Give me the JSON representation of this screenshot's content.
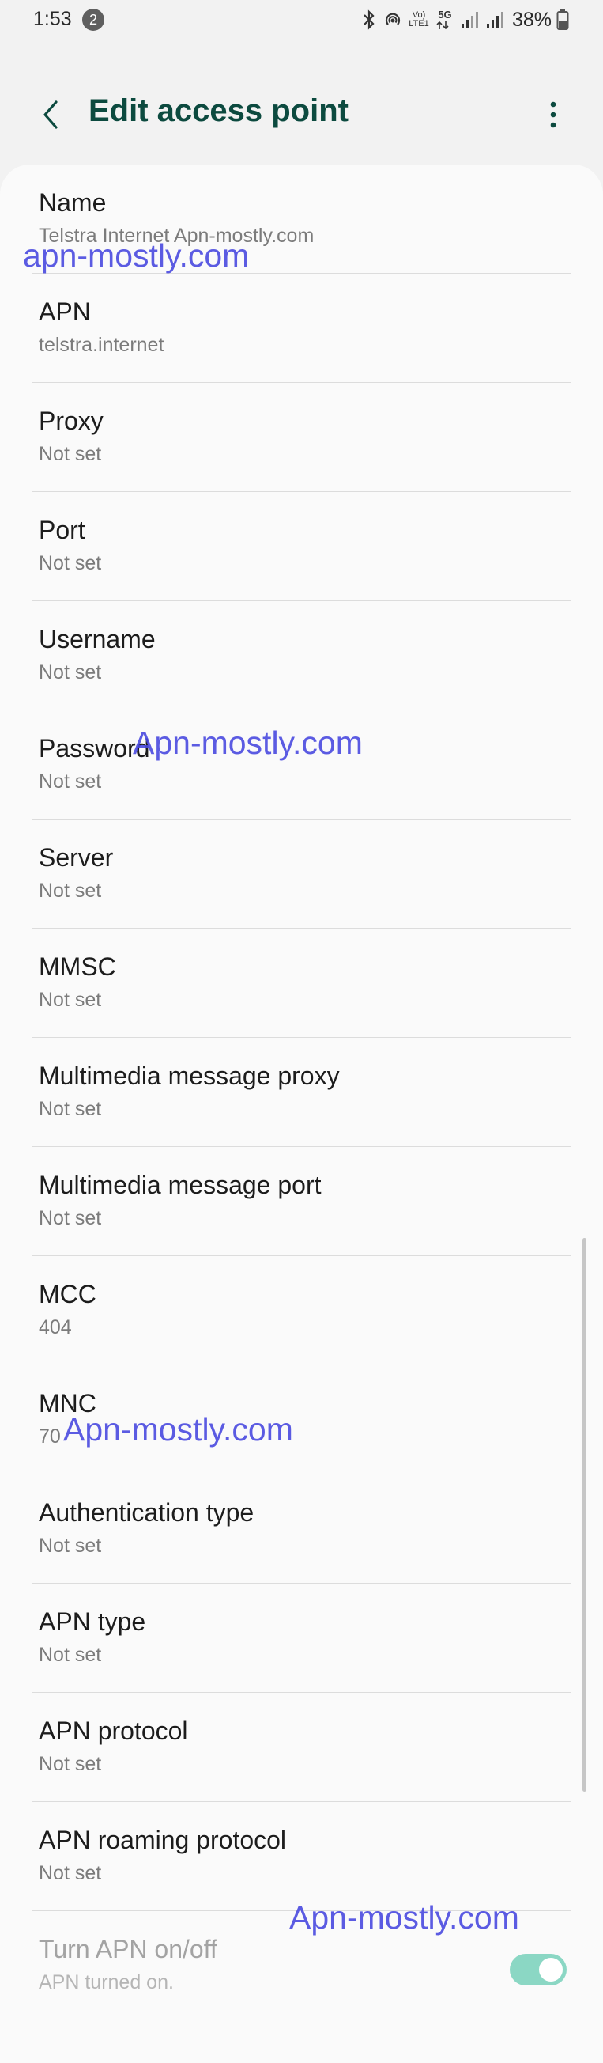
{
  "status_bar": {
    "time": "1:53",
    "notification_count": "2",
    "volte_label": "Vo)\nLTE1",
    "network_label": "5G",
    "battery_percent": "38%"
  },
  "header": {
    "title": "Edit access point"
  },
  "fields": [
    {
      "title": "Name",
      "value": "Telstra Internet Apn-mostly.com"
    },
    {
      "title": "APN",
      "value": "telstra.internet"
    },
    {
      "title": "Proxy",
      "value": "Not set"
    },
    {
      "title": "Port",
      "value": "Not set"
    },
    {
      "title": "Username",
      "value": "Not set"
    },
    {
      "title": "Password",
      "value": "Not set"
    },
    {
      "title": "Server",
      "value": "Not set"
    },
    {
      "title": "MMSC",
      "value": "Not set"
    },
    {
      "title": "Multimedia message proxy",
      "value": "Not set"
    },
    {
      "title": "Multimedia message port",
      "value": "Not set"
    },
    {
      "title": "MCC",
      "value": "404"
    },
    {
      "title": "MNC",
      "value": "70"
    },
    {
      "title": "Authentication type",
      "value": "Not set"
    },
    {
      "title": "APN type",
      "value": "Not set"
    },
    {
      "title": "APN protocol",
      "value": "Not set"
    },
    {
      "title": "APN roaming protocol",
      "value": "Not set"
    }
  ],
  "apn_toggle": {
    "title": "Turn APN on/off",
    "value": "APN turned on.",
    "enabled": true
  },
  "watermarks": [
    "apn-mostly.com",
    "Apn-mostly.com",
    "Apn-mostly.com",
    "Apn-mostly.com"
  ],
  "colors": {
    "title": "#0c4a3f",
    "toggle_on": "#8bd7c4",
    "watermark": "#4a4ae0"
  }
}
